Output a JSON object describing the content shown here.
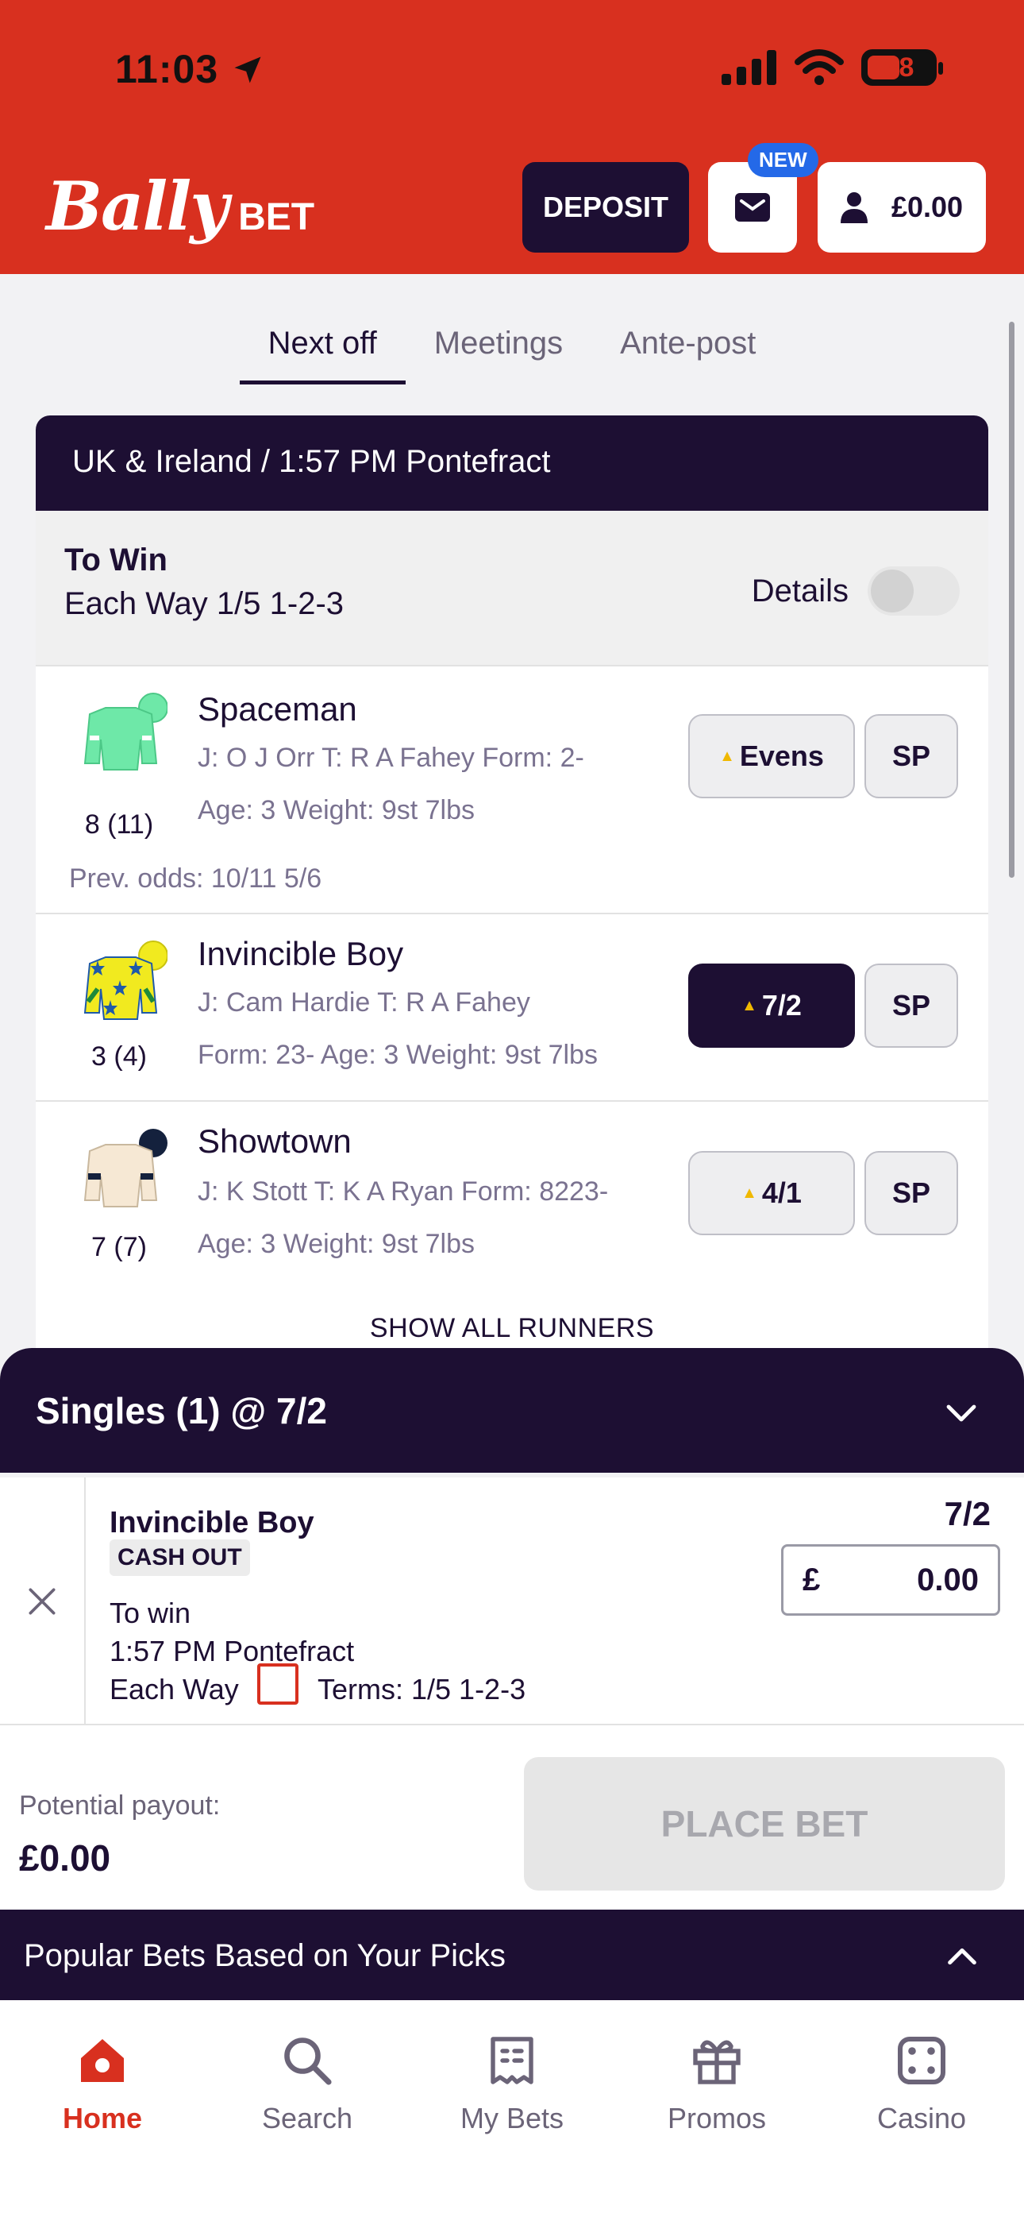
{
  "status_bar": {
    "time": "11:03",
    "battery": "38"
  },
  "header": {
    "logo_main": "Bally",
    "logo_sub": "BET",
    "deposit_label": "DEPOSIT",
    "new_badge": "NEW",
    "balance": "£0.00"
  },
  "tabs": [
    {
      "label": "Next off",
      "active": true
    },
    {
      "label": "Meetings",
      "active": false
    },
    {
      "label": "Ante-post",
      "active": false
    }
  ],
  "race": {
    "title": "UK & Ireland / 1:57 PM Pontefract",
    "market": "To Win",
    "each_way": "Each Way 1/5 1-2-3",
    "details_label": "Details",
    "runners": [
      {
        "name": "Spaceman",
        "number": "8 (11)",
        "line1": "J: O J Orr T: R A Fahey Form: 2-",
        "line2": "Age: 3 Weight: 9st 7lbs",
        "prev_odds": "Prev. odds: 10/11 5/6",
        "odds": "Evens",
        "sp": "SP",
        "silk_color": "#6ee8a8",
        "cap_color": "#6ee8a8",
        "selected": false
      },
      {
        "name": "Invincible Boy",
        "number": "3 (4)",
        "line1": "J: Cam Hardie T: R A Fahey",
        "line2": "Form: 23- Age: 3 Weight: 9st 7lbs",
        "odds": "7/2",
        "sp": "SP",
        "silk_color": "#f1ea1f",
        "cap_color": "#f1ea1f",
        "selected": true
      },
      {
        "name": "Showtown",
        "number": "7 (7)",
        "line1": "J: K Stott T: K A Ryan Form: 8223-",
        "line2": "Age: 3 Weight: 9st 7lbs",
        "odds": "4/1",
        "sp": "SP",
        "silk_color": "#f6e8d4",
        "cap_color": "#14213d",
        "selected": false
      }
    ],
    "show_all": "SHOW ALL RUNNERS"
  },
  "betslip": {
    "title": "Singles (1) @ 7/2",
    "selection": "Invincible Boy",
    "cash_out": "CASH OUT",
    "market": "To win",
    "race": "1:57 PM Pontefract",
    "each_way_label": "Each Way",
    "terms": "Terms: 1/5 1-2-3",
    "odds": "7/2",
    "currency": "£",
    "stake": "0.00",
    "payout_label": "Potential payout:",
    "payout_value": "£0.00",
    "place_bet": "PLACE BET"
  },
  "popular": {
    "label": "Popular Bets Based on Your Picks"
  },
  "nav": [
    {
      "label": "Home",
      "icon": "home-icon",
      "active": true
    },
    {
      "label": "Search",
      "icon": "search-icon",
      "active": false
    },
    {
      "label": "My Bets",
      "icon": "receipt-icon",
      "active": false
    },
    {
      "label": "Promos",
      "icon": "gift-icon",
      "active": false
    },
    {
      "label": "Casino",
      "icon": "dice-icon",
      "active": false
    }
  ],
  "colors": {
    "brand_red": "#d8301f",
    "dark_purple": "#1d0f33",
    "odds_up": "#f0b800",
    "badge_blue": "#2469e8"
  }
}
